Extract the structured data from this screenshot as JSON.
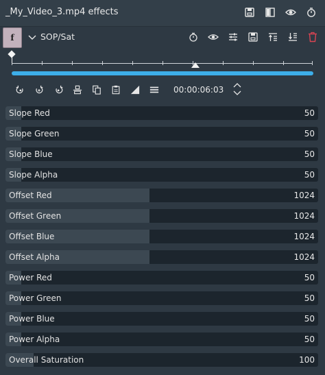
{
  "window": {
    "title": "_My_Video_3.mp4 effects",
    "icons": [
      "save-stack-icon",
      "compare-split-icon",
      "eye-icon",
      "timer-icon"
    ]
  },
  "effect": {
    "collapse_badge": "f",
    "name": "SOP/Sat",
    "icons": [
      "timer-icon",
      "eye-icon",
      "sliders-icon",
      "save-icon",
      "move-up-icon",
      "move-down-icon",
      "delete-icon"
    ],
    "delete_color": "#da4453"
  },
  "timeline": {
    "accent": "#3daee9"
  },
  "toolbar": {
    "icons": [
      "previous-keyframe-icon",
      "add-keyframe-icon",
      "next-keyframe-icon",
      "align-icon",
      "copy-icon",
      "paste-icon",
      "curve-icon",
      "menu-icon"
    ],
    "timecode": "00:00:06:03"
  },
  "params": [
    {
      "label": "Slope Red",
      "value": "50",
      "level": 0.05
    },
    {
      "label": "Slope Green",
      "value": "50",
      "level": 0.05
    },
    {
      "label": "Slope Blue",
      "value": "50",
      "level": 0.05
    },
    {
      "label": "Slope Alpha",
      "value": "50",
      "level": 0.05
    },
    {
      "label": "Offset Red",
      "value": "1024",
      "level": 0.46
    },
    {
      "label": "Offset Green",
      "value": "1024",
      "level": 0.46
    },
    {
      "label": "Offset Blue",
      "value": "1024",
      "level": 0.46
    },
    {
      "label": "Offset Alpha",
      "value": "1024",
      "level": 0.46
    },
    {
      "label": "Power Red",
      "value": "50",
      "level": 0.05
    },
    {
      "label": "Power Green",
      "value": "50",
      "level": 0.05
    },
    {
      "label": "Power Blue",
      "value": "50",
      "level": 0.05
    },
    {
      "label": "Power Alpha",
      "value": "50",
      "level": 0.05
    },
    {
      "label": "Overall Saturation",
      "value": "100",
      "level": 0.09
    }
  ]
}
